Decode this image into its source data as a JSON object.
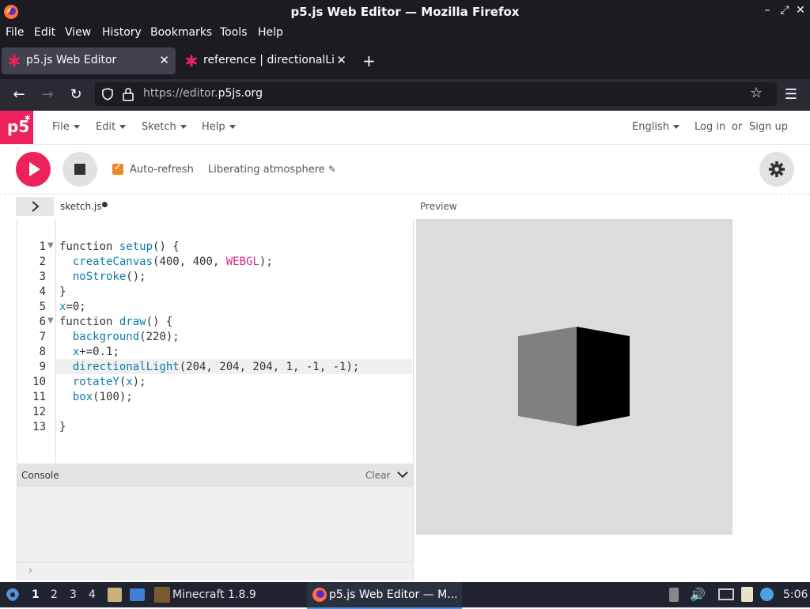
{
  "window": {
    "title": "p5.js Web Editor — Mozilla Firefox"
  },
  "menubar": [
    "File",
    "Edit",
    "View",
    "History",
    "Bookmarks",
    "Tools",
    "Help"
  ],
  "tabs": [
    {
      "label": "p5.js Web Editor",
      "active": true
    },
    {
      "label": "reference | directionalLig",
      "active": false
    }
  ],
  "nav": {
    "url_dim": "https://editor.",
    "url_main": "p5js.org"
  },
  "p5header": {
    "logo": "p5",
    "menus": [
      "File",
      "Edit",
      "Sketch",
      "Help"
    ],
    "language": "English",
    "login": "Log in",
    "or": "or",
    "signup": "Sign up"
  },
  "toolbar": {
    "auto_refresh_label": "Auto-refresh",
    "auto_refresh_checked": true,
    "sketch_name": "Liberating atmosphere"
  },
  "editor": {
    "file_name": "sketch.js",
    "preview_label": "Preview",
    "active_line": 9,
    "line_numbers": [
      "1",
      "2",
      "3",
      "4",
      "5",
      "6",
      "7",
      "8",
      "9",
      "10",
      "11",
      "12",
      "13"
    ]
  },
  "console": {
    "label": "Console",
    "clear_label": "Clear"
  },
  "taskbar": {
    "workspaces": [
      "1",
      "2",
      "3",
      "4"
    ],
    "active_workspace": "1",
    "minecraft_label": "Minecraft 1.8.9",
    "firefox_label": "p5.js Web Editor — M...",
    "time": "5:06"
  },
  "colors": {
    "p5_pink": "#ed225d",
    "checkbox_orange": "#f0862a",
    "firefox_dark": "#1c1b22",
    "preview_bg": "#dcdcdc"
  }
}
